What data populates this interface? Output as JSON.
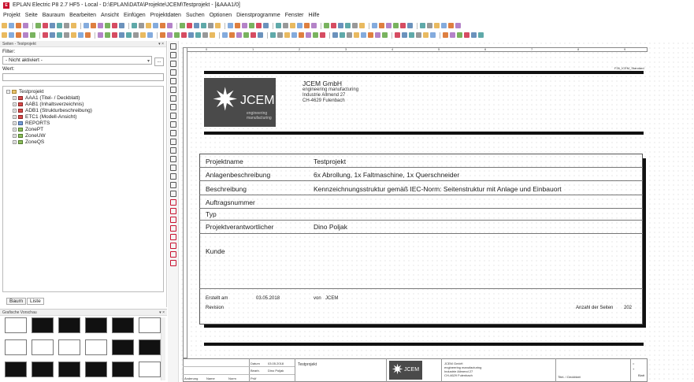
{
  "window": {
    "title": "EPLAN Electric P8 2.7 HF5 - Local - D:\\EPLAN\\DATA\\Projekte\\JCEM\\Testprojekt - [&AAA1/0]",
    "icon": "eplan-app-icon"
  },
  "menu": [
    "Projekt",
    "Seite",
    "Bauraum",
    "Bearbeiten",
    "Ansicht",
    "Einfügen",
    "Projektdaten",
    "Suchen",
    "Optionen",
    "Dienstprogramme",
    "Fenster",
    "Hilfe"
  ],
  "pages_pane": {
    "header": "Seiten - Testprojekt",
    "filter_label": "Filter:",
    "filter_value": "- Nicht aktiviert -",
    "filter_button": "...",
    "value_label": "Wert:",
    "value_input": "",
    "tree": [
      {
        "label": "Testprojekt",
        "icon": "project-icon",
        "expanded": true,
        "level": 0
      },
      {
        "label": "AAA1 (Titel- / Deckblatt)",
        "icon": "page-folder-icon",
        "level": 1
      },
      {
        "label": "AAB1 (Inhaltsverzeichnis)",
        "icon": "page-folder-icon",
        "level": 1
      },
      {
        "label": "ADB1 (Strukturbeschreibung)",
        "icon": "page-folder-icon",
        "level": 1
      },
      {
        "label": "ETC1 (Modell-Ansicht)",
        "icon": "page-folder-icon",
        "level": 1
      },
      {
        "label": "REPORTS",
        "icon": "report-folder-icon",
        "level": 1
      },
      {
        "label": "ZonePT",
        "icon": "zone-folder-icon",
        "level": 1
      },
      {
        "label": "ZoneUW",
        "icon": "zone-folder-icon",
        "level": 1
      },
      {
        "label": "ZoneQS",
        "icon": "zone-folder-icon",
        "level": 1
      }
    ],
    "tabs": [
      "Baum",
      "Liste"
    ],
    "selected_tab": "Baum"
  },
  "preview_pane": {
    "header": "Grafische Vorschau"
  },
  "drawing": {
    "doc_tag": "F26_ICEM_Standard",
    "logo": {
      "text": "JCEM",
      "sub1": "engineering",
      "sub2": "manufacturing"
    },
    "company": {
      "name": "JCEM GmbH",
      "line1": "engineering manufacturing",
      "line2": "Industrie Allmend 27",
      "line3": "CH-4629 Fulenbach"
    },
    "fields": [
      {
        "label": "Projektname",
        "value": "Testprojekt"
      },
      {
        "label": "Anlagenbeschreibung",
        "value": "6x Abrollung, 1x Faltmaschine, 1x Querschneider"
      },
      {
        "label": "Beschreibung",
        "value": "Kennzeichnungsstruktur gemäß IEC-Norm: Seitenstruktur mit Anlage und Einbauort"
      },
      {
        "label": "Auftragsnummer",
        "value": ""
      },
      {
        "label": "Typ",
        "value": ""
      },
      {
        "label": "Projektverantwortlicher",
        "value": "Dino Poljak"
      },
      {
        "label": "Kunde",
        "value": ""
      }
    ],
    "footer": {
      "created_label": "Erstellt am",
      "created_date": "03.05.2018",
      "by_label": "von",
      "by_value": "JCEM",
      "revision_label": "Revision",
      "pages_label": "Anzahl der Seiten",
      "pages_value": "202"
    },
    "titleblock": {
      "datum_label": "Datum",
      "datum_value": "03.05.2018",
      "bearb_label": "Bearb.",
      "bearb_value": "Dino Poljak",
      "pruef_label": "Prüf",
      "project": "Testprojekt",
      "company": "JCEM GmbH",
      "company_l1": "engineering manufacturing",
      "company_l2": "Industrie Allmend 27",
      "company_l3": "CH-4629 Fulenbach",
      "sheet_title": "Titel- / Deckblatt",
      "aenderung_label": "Änderung",
      "name_label": "Name",
      "orig_label": "Norm",
      "bl_label": "Blatt",
      "plus": "+",
      "eq": "="
    },
    "ruler_marks": [
      "0",
      "1",
      "2",
      "3",
      "4",
      "5",
      "6",
      "7",
      "8",
      "9"
    ]
  }
}
